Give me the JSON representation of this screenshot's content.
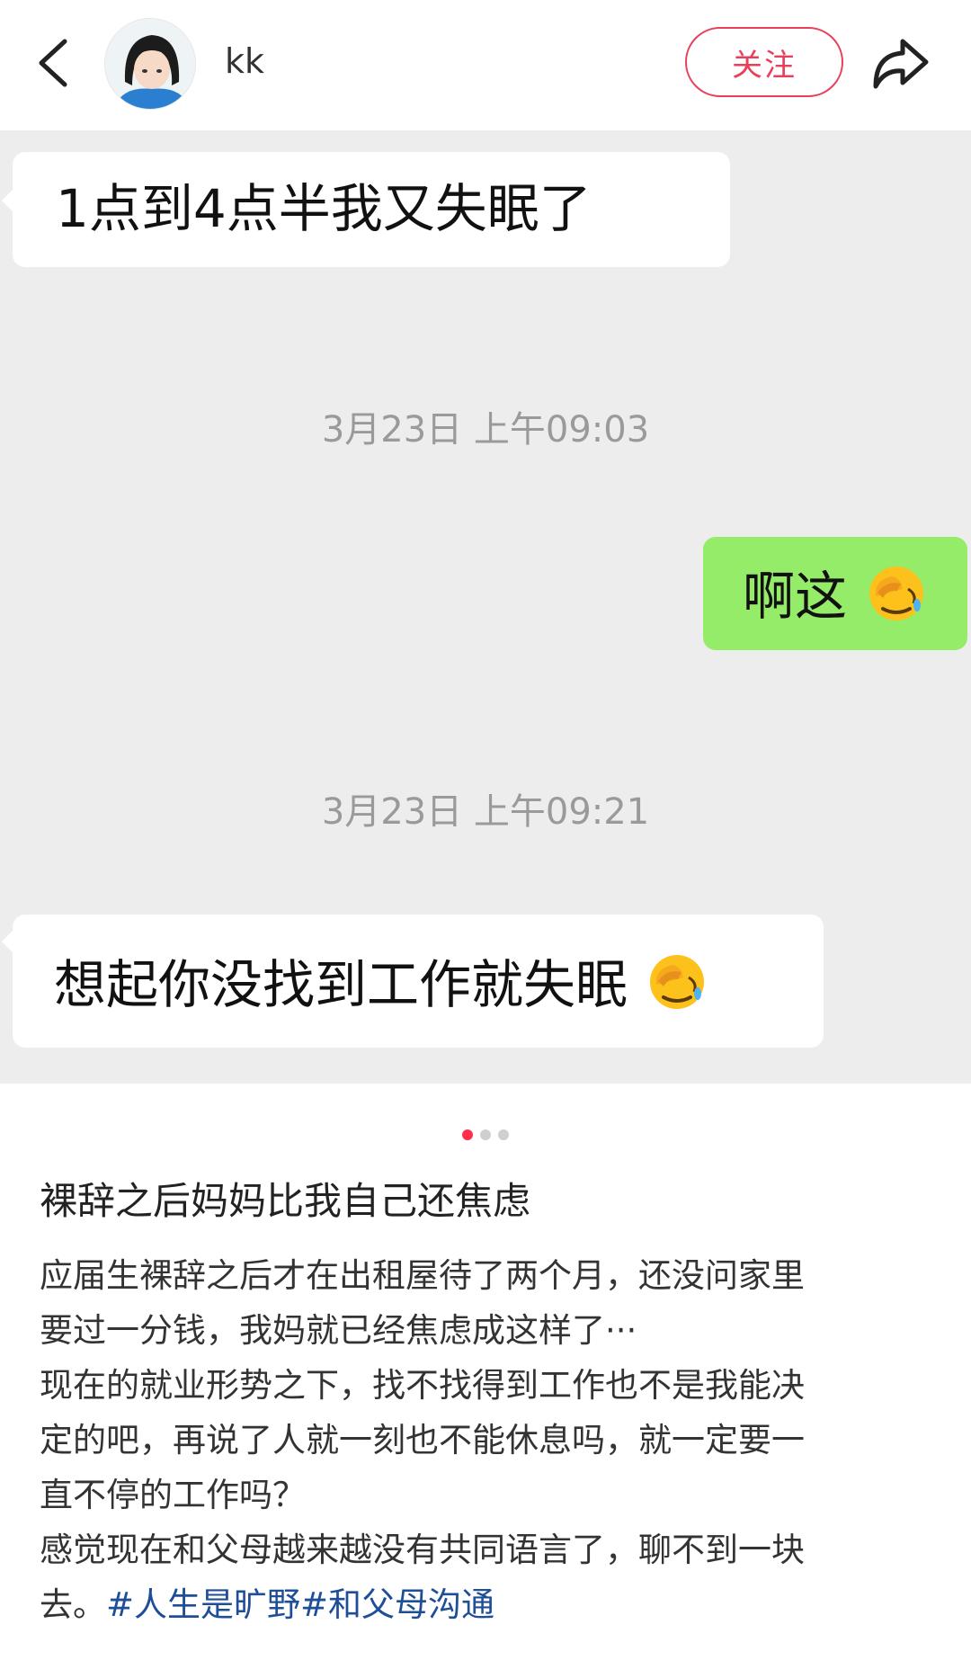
{
  "header": {
    "username": "kk",
    "follow_label": "关注",
    "icons": [
      "back-chevron-icon",
      "share-arrow-icon"
    ]
  },
  "chat": {
    "messages": [
      {
        "side": "left",
        "text": "1点到4点半我又失眠了"
      },
      {
        "side": "time",
        "text": "3月23日 上午09:03"
      },
      {
        "side": "right",
        "text": "啊这",
        "emoji": "face-palm-crying-emoji"
      },
      {
        "side": "time",
        "text": "3月23日 上午09:21"
      },
      {
        "side": "left",
        "text": "想起你没找到工作就失眠",
        "emoji": "face-palm-crying-emoji"
      }
    ],
    "colors": {
      "background": "#ededed",
      "left_bubble": "#ffffff",
      "right_bubble": "#95ec69",
      "timestamp": "#9a9a9a"
    }
  },
  "pager": {
    "count": 3,
    "active_index": 0,
    "active_color": "#ff2e4d"
  },
  "post": {
    "title": "裸辞之后妈妈比我自己还焦虑",
    "lines": [
      "应届生裸辞之后才在出租屋待了两个月，还没问家里",
      "要过一分钱，我妈就已经焦虑成这样了···",
      "现在的就业形势之下，找不找得到工作也不是我能决",
      "定的吧，再说了人就一刻也不能休息吗，就一定要一",
      "直不停的工作吗？",
      "感觉现在和父母越来越没有共同语言了，聊不到一块"
    ],
    "last_line_prefix": "去。",
    "tags": [
      "#人生是旷野",
      "#和父母沟通"
    ],
    "tag_color": "#1f4e99"
  },
  "colors": {
    "accent": "#e8405a"
  }
}
